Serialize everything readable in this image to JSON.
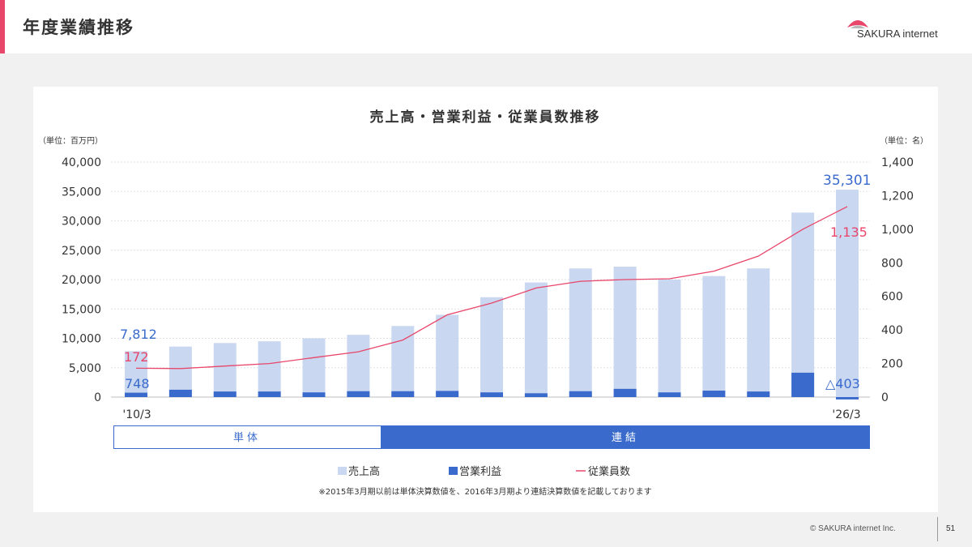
{
  "header": {
    "title": "年度業績推移",
    "logo_text": "SAKURA internet"
  },
  "footer": {
    "copyright": "© SAKURA internet Inc.",
    "page_number": "51"
  },
  "note": "※2015年3月期以前は単体決算数値を、2016年3月期より連結決算数値を記載しております",
  "segments": {
    "standalone": "単体",
    "consolidated": "連結"
  },
  "colors": {
    "sales": "#c9d7f0",
    "operating_profit": "#3a6bcc",
    "employees": "#e8466a",
    "accent": "#e8466a",
    "consolidated_band": "#3a6bcc"
  },
  "chart_data": {
    "type": "bar",
    "title": "売上高・営業利益・従業員数推移",
    "y_left_unit": "（単位：百万円）",
    "y_right_unit": "（単位：名）",
    "y_left_range": [
      0,
      40000
    ],
    "y_right_range": [
      0,
      1400
    ],
    "y_left_ticks": [
      "0",
      "5,000",
      "10,000",
      "15,000",
      "20,000",
      "25,000",
      "30,000",
      "35,000",
      "40,000"
    ],
    "y_right_ticks": [
      "0",
      "200",
      "400",
      "600",
      "800",
      "1,000",
      "1,200",
      "1,400"
    ],
    "x_first_label": "'10/3",
    "x_last_label": "'26/3",
    "grid": true,
    "legend_position": "bottom",
    "legend": [
      "売上高",
      "営業利益",
      "従業員数"
    ],
    "series": [
      {
        "name": "売上高",
        "type": "bar",
        "values": [
          7812,
          8600,
          9200,
          9500,
          10000,
          10600,
          12100,
          14000,
          17000,
          19500,
          21900,
          22200,
          20000,
          20600,
          21900,
          31400,
          35301
        ]
      },
      {
        "name": "営業利益",
        "type": "bar",
        "values": [
          748,
          1250,
          950,
          950,
          800,
          1000,
          1000,
          1050,
          800,
          650,
          1000,
          1400,
          800,
          1100,
          950,
          4150,
          -403
        ]
      },
      {
        "name": "従業員数",
        "type": "line",
        "axis": "right",
        "values": [
          172,
          170,
          185,
          200,
          235,
          270,
          340,
          490,
          560,
          650,
          690,
          700,
          705,
          750,
          840,
          1000,
          1135
        ]
      }
    ],
    "labels": {
      "sales_first": "7,812",
      "sales_last": "35,301",
      "op_first": "748",
      "op_last": "△403",
      "emp_first": "172",
      "emp_last": "1,135"
    }
  }
}
